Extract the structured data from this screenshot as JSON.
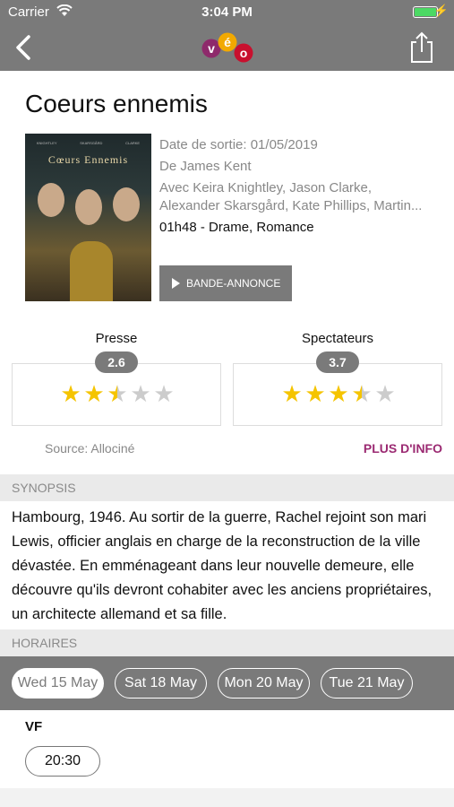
{
  "status_bar": {
    "carrier": "Carrier",
    "time": "3:04 PM"
  },
  "logo": {
    "letters": [
      "v",
      "é",
      "o"
    ],
    "colors": [
      "#8e2a6b",
      "#f2a900",
      "#c8102e"
    ]
  },
  "movie": {
    "title": "Coeurs ennemis",
    "poster_title": "Cœurs Ennemis",
    "poster_names": [
      "KNIGHTLEY",
      "SKARSGÅRD",
      "CLARKE"
    ],
    "release": "Date de sortie: 01/05/2019",
    "director": "De James Kent",
    "cast_line1": "Avec Keira Knightley, Jason Clarke,",
    "cast_line2": "Alexander Skarsgård, Kate Phillips, Martin...",
    "duration_genre": "01h48 - Drame, Romance",
    "trailer_label": "BANDE-ANNONCE"
  },
  "ratings": {
    "press": {
      "label": "Presse",
      "value": "2.6",
      "stars": 2.5
    },
    "audience": {
      "label": "Spectateurs",
      "value": "3.7",
      "stars": 3.5
    }
  },
  "source": "Source: Allociné",
  "more_info": "PLUS D'INFO",
  "synopsis": {
    "header": "SYNOPSIS",
    "text": "Hambourg, 1946. Au sortir de la guerre, Rachel rejoint son mari Lewis, officier anglais en charge de la reconstruction de la ville dévastée. En emménageant dans leur nouvelle demeure, elle découvre qu'ils devront cohabiter avec les anciens propriétaires, un architecte allemand et sa fille."
  },
  "schedule": {
    "header": "HORAIRES",
    "dates": [
      "Wed 15 May",
      "Sat 18 May",
      "Mon 20 May",
      "Tue 21 May"
    ],
    "selected_date": "Wed 15 May",
    "version": "VF",
    "times": [
      "20:30"
    ]
  }
}
